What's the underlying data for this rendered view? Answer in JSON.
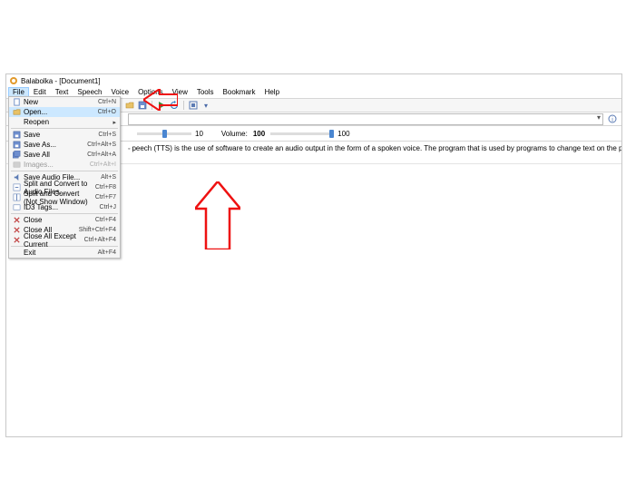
{
  "title": {
    "app": "Balabolka",
    "doc": "[Document1]"
  },
  "menu": {
    "file": "File",
    "edit": "Edit",
    "text": "Text",
    "speech": "Speech",
    "voice": "Voice",
    "options": "Options",
    "view": "View",
    "tools": "Tools",
    "bookmark": "Bookmark",
    "help": "Help"
  },
  "file_menu": [
    {
      "icon": "new",
      "label": "New",
      "accel": "Ctrl+N"
    },
    {
      "icon": "open",
      "label": "Open...",
      "accel": "Ctrl+O",
      "highlight": true
    },
    {
      "icon": "",
      "label": "Reopen",
      "accel": "",
      "submenu": true
    },
    {
      "sep": true
    },
    {
      "icon": "save",
      "label": "Save",
      "accel": "Ctrl+S"
    },
    {
      "icon": "saveas",
      "label": "Save As...",
      "accel": "Ctrl+Alt+S"
    },
    {
      "icon": "saveall",
      "label": "Save All",
      "accel": "Ctrl+Alt+A"
    },
    {
      "icon": "img",
      "label": "Images...",
      "accel": "Ctrl+Alt+I",
      "disabled": true
    },
    {
      "sep": true
    },
    {
      "icon": "audio",
      "label": "Save Audio File...",
      "accel": "Alt+S"
    },
    {
      "icon": "conv",
      "label": "Split and Convert to Audio Files...",
      "accel": "Ctrl+F8"
    },
    {
      "icon": "split",
      "label": "Split and Convert (Not Show Window)",
      "accel": "Ctrl+F7"
    },
    {
      "icon": "id3",
      "label": "ID3 Tags...",
      "accel": "Ctrl+J"
    },
    {
      "sep": true
    },
    {
      "icon": "close",
      "label": "Close",
      "accel": "Ctrl+F4"
    },
    {
      "icon": "closeall",
      "label": "Close All",
      "accel": "Shift+Ctrl+F4"
    },
    {
      "icon": "closeex",
      "label": "Close All Except Current",
      "accel": "Ctrl+Alt+F4"
    },
    {
      "sep": true
    },
    {
      "icon": "",
      "label": "Exit",
      "accel": "Alt+F4"
    }
  ],
  "sliders": {
    "left_min": " ",
    "left_val": "10",
    "vol_label": "Volume:",
    "vol_val": "100",
    "vol_max": "100"
  },
  "content": {
    "text": "peech (TTS) is the use of software to create an audio output in the form of a spoken voice. The program that is used by programs to change text on the page to an audio output of the spoken voice is normally a text to speech engine."
  }
}
